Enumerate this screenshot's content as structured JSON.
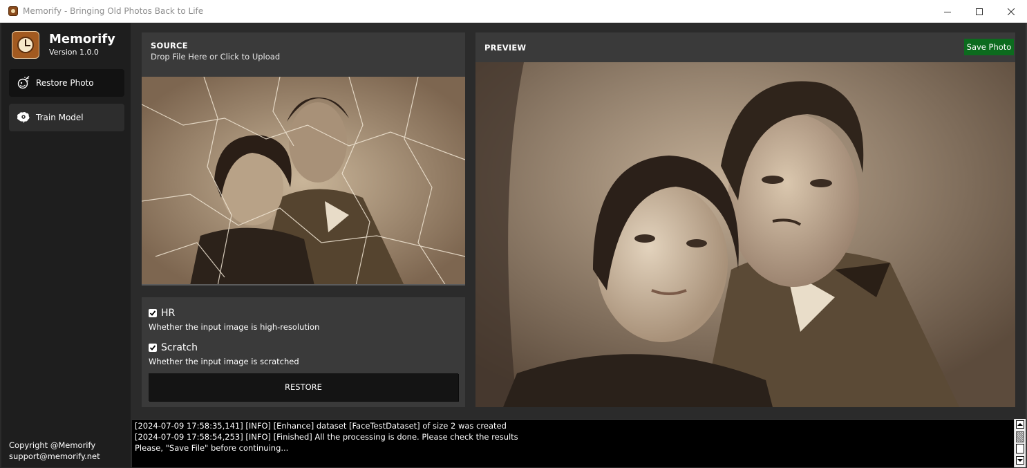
{
  "window": {
    "app_name": "Memorify",
    "title_separator": " - ",
    "title_tagline": "Bringing Old Photos Back to Life"
  },
  "sidebar": {
    "brand_name": "Memorify",
    "version": "Version 1.0.0",
    "nav": [
      {
        "label": "Restore Photo",
        "icon": "restore-photo-icon",
        "active": true
      },
      {
        "label": "Train Model",
        "icon": "brain-gear-icon",
        "active": false
      }
    ],
    "footer": {
      "copyright": "Copyright @Memorify",
      "email": "support@memorify.net"
    }
  },
  "source": {
    "title": "SOURCE",
    "subtitle": "Drop File Here or Click to Upload"
  },
  "options": {
    "hr": {
      "label": "HR",
      "checked": true,
      "description": "Whether the input image is high-resolution"
    },
    "scratch": {
      "label": "Scratch",
      "checked": true,
      "description": "Whether the input image is scratched"
    },
    "restore_label": "RESTORE"
  },
  "preview": {
    "title": "PREVIEW",
    "save_label": "Save Photo"
  },
  "log": {
    "lines": [
      "[2024-07-09 17:58:35,141] [INFO] [Enhance] dataset [FaceTestDataset] of size 2 was created",
      "[2024-07-09 17:58:54,253] [INFO] [Finished] All the processing is done. Please check the results",
      "Please, \"Save File\" before continuing..."
    ]
  },
  "colors": {
    "sidebar_bg": "#1e1e1e",
    "panel_bg": "#3a3a3a",
    "save_button": "#0c6b1e",
    "log_bg": "#000000"
  }
}
